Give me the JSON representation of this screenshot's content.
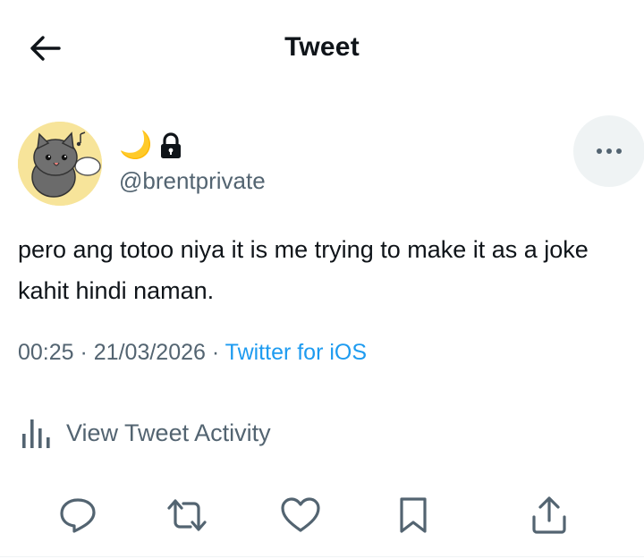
{
  "header": {
    "title": "Tweet",
    "back_icon": "arrow-left-icon"
  },
  "author": {
    "display_name": "🌙",
    "handle": "@brentprivate",
    "protected_icon": "lock-icon",
    "avatar_icon": "cat-avatar"
  },
  "tweet": {
    "text": "pero ang totoo niya it is me trying to make it as a joke kahit hindi naman.",
    "time": "00:25",
    "date": "21/03/2026",
    "separator": " · ",
    "source": "Twitter for iOS"
  },
  "activity": {
    "label": "View Tweet Activity",
    "icon": "bar-chart-icon"
  },
  "actions": [
    {
      "name": "reply",
      "icon": "reply-icon"
    },
    {
      "name": "retweet",
      "icon": "retweet-icon"
    },
    {
      "name": "like",
      "icon": "heart-icon"
    },
    {
      "name": "bookmark",
      "icon": "bookmark-icon"
    },
    {
      "name": "share",
      "icon": "share-icon"
    }
  ],
  "colors": {
    "text": "#0f1419",
    "secondary": "#536471",
    "link": "#1d9bf0",
    "more_button_bg": "#eff3f4",
    "avatar_bg": "#f7e49a"
  }
}
